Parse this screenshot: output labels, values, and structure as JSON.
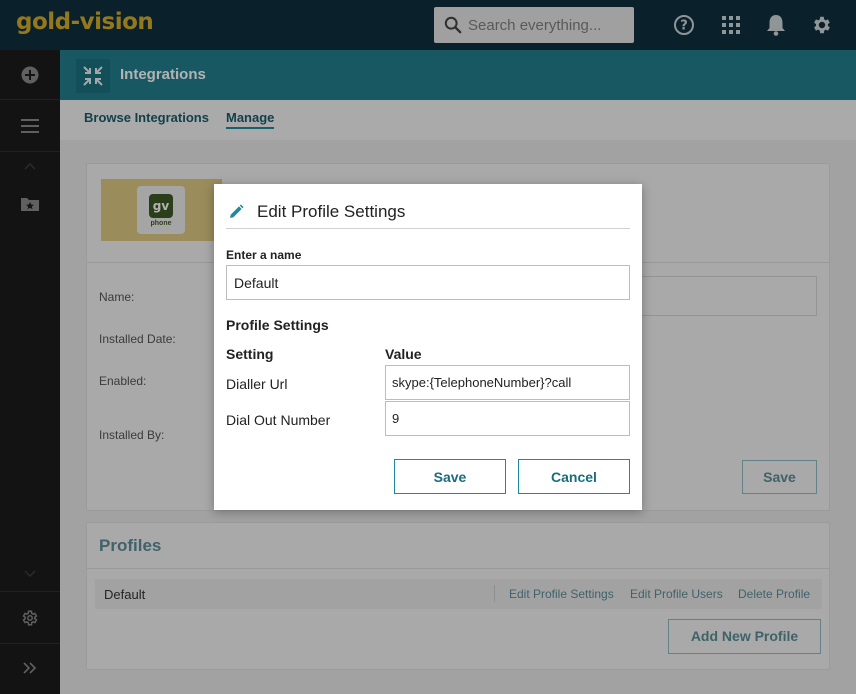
{
  "app": {
    "logo_part1": "gold",
    "logo_dash": "-",
    "logo_part2": "vision"
  },
  "search": {
    "placeholder": "Search everything..."
  },
  "topbar_icons": [
    "help-icon",
    "apps-grid-icon",
    "bell-icon",
    "gear-icon"
  ],
  "sidebar": {
    "items": [
      "add-icon",
      "menu-icon",
      "chevron-up-icon",
      "folder-star-icon",
      "chevron-down-icon",
      "gear-icon",
      "expand-icon"
    ]
  },
  "header": {
    "title": "Integrations",
    "icon": "compress-arrows-icon"
  },
  "tabs": [
    {
      "label": "Browse Integrations",
      "active": false
    },
    {
      "label": "Manage",
      "active": true
    }
  ],
  "integration": {
    "icon_text": "gv",
    "icon_subtext": "phone",
    "details": [
      {
        "label": "Name:"
      },
      {
        "label": "Installed Date:"
      },
      {
        "label": "Enabled:"
      },
      {
        "label": "Installed By:"
      }
    ],
    "save_label": "Save"
  },
  "profiles": {
    "title": "Profiles",
    "rows": [
      {
        "name": "Default"
      }
    ],
    "actions": [
      "Edit Profile Settings",
      "Edit Profile Users",
      "Delete Profile"
    ],
    "add_label": "Add New Profile"
  },
  "modal": {
    "title": "Edit Profile Settings",
    "name_label": "Enter a name",
    "name_value": "Default",
    "section_title": "Profile Settings",
    "col_setting": "Setting",
    "col_value": "Value",
    "settings": [
      {
        "setting": "Dialler Url",
        "value": "skype:{TelephoneNumber}?call"
      },
      {
        "setting": "Dial Out Number",
        "value": "9"
      }
    ],
    "save_label": "Save",
    "cancel_label": "Cancel"
  },
  "colors": {
    "topbar": "#0f2e3d",
    "accent": "#1d8a9b",
    "brand_gold": "#d4ac2b",
    "sidebar": "#1c1c1c"
  }
}
